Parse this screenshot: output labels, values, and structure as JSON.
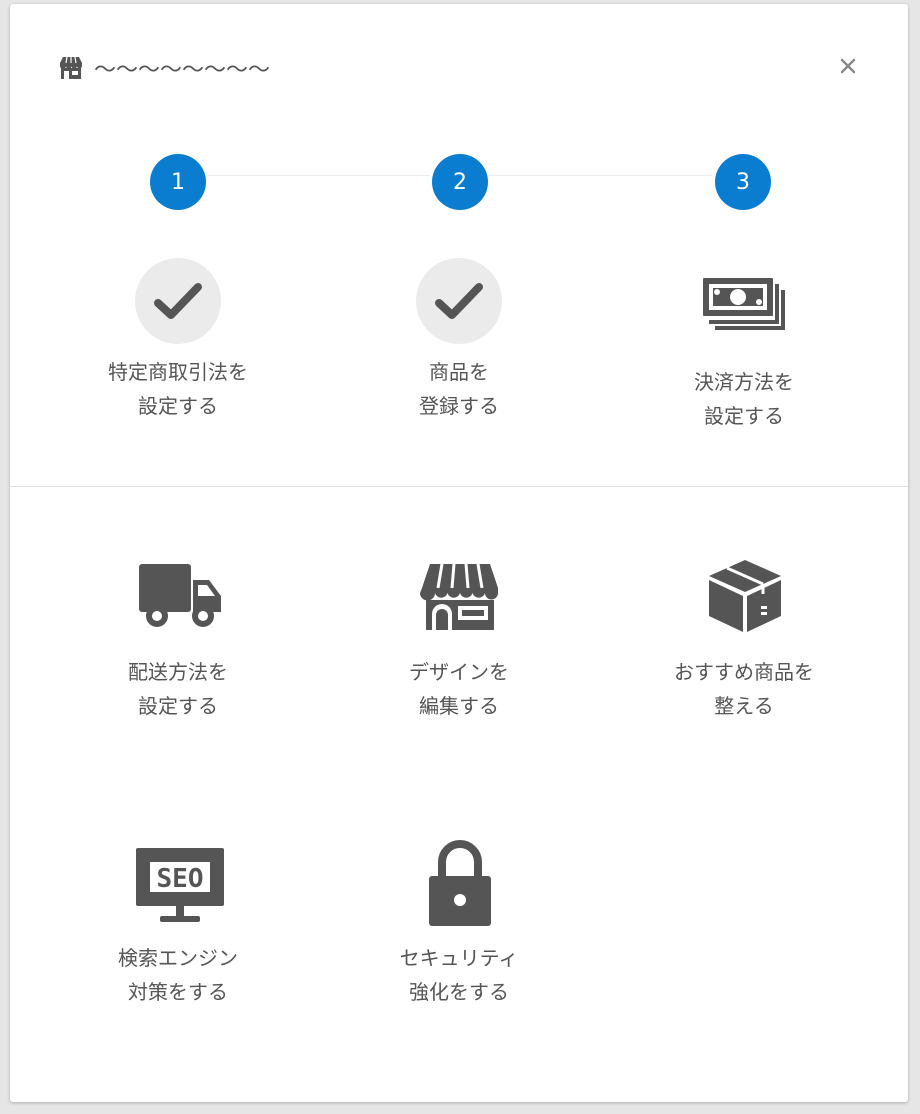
{
  "header": {
    "title": "〜〜〜〜〜〜〜〜",
    "close_label": "×"
  },
  "steps": [
    {
      "number": "1",
      "line1": "特定商取引法を",
      "line2": "設定する",
      "status": "done",
      "icon": "check-icon"
    },
    {
      "number": "2",
      "line1": "商品を",
      "line2": "登録する",
      "status": "done",
      "icon": "check-icon"
    },
    {
      "number": "3",
      "line1": "決済方法を",
      "line2": "設定する",
      "status": "pending",
      "icon": "money-icon"
    }
  ],
  "tasks": [
    {
      "icon": "truck-icon",
      "line1": "配送方法を",
      "line2": "設定する"
    },
    {
      "icon": "storefront-icon",
      "line1": "デザインを",
      "line2": "編集する"
    },
    {
      "icon": "box-icon",
      "line1": "おすすめ商品を",
      "line2": "整える"
    },
    {
      "icon": "seo-monitor-icon",
      "line1": "検索エンジン",
      "line2": "対策をする"
    },
    {
      "icon": "lock-icon",
      "line1": "セキュリティ",
      "line2": "強化をする"
    }
  ],
  "colors": {
    "accent": "#0a7dd1",
    "icon": "#555555",
    "text": "#555555"
  }
}
